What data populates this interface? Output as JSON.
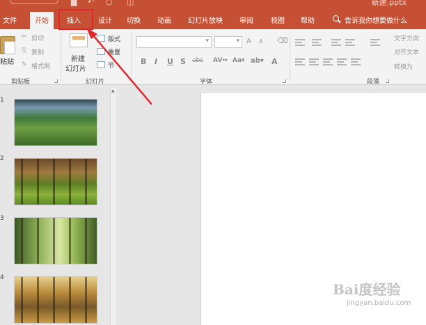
{
  "titlebar": {
    "filename": "新建.pptx"
  },
  "tabs": [
    {
      "label": "文件",
      "active": false
    },
    {
      "label": "开始",
      "active": true
    },
    {
      "label": "插入",
      "active": false
    },
    {
      "label": "设计",
      "active": false
    },
    {
      "label": "切换",
      "active": false
    },
    {
      "label": "动画",
      "active": false
    },
    {
      "label": "幻灯片放映",
      "active": false
    },
    {
      "label": "审阅",
      "active": false
    },
    {
      "label": "视图",
      "active": false
    },
    {
      "label": "帮助",
      "active": false
    }
  ],
  "tell_me": {
    "placeholder": "告诉我你想要做什么"
  },
  "ribbon": {
    "clipboard": {
      "label": "剪贴板",
      "paste": "粘贴",
      "cut": "剪切",
      "copy": "复制",
      "format_painter": "格式刷"
    },
    "slides": {
      "label": "幻灯片",
      "new_slide_line1": "新建",
      "new_slide_line2": "幻灯片",
      "layout": "版式",
      "reset": "重置",
      "section": "节"
    },
    "font": {
      "label": "字体",
      "bold": "B",
      "italic": "I",
      "underline": "U",
      "shadow": "S",
      "strike": "abc",
      "grow": "A",
      "shrink": "A",
      "color": "A"
    },
    "paragraph": {
      "label": "段落",
      "text_direction": "文字方向",
      "align_text": "对齐文本",
      "smartart": "转换为"
    }
  },
  "slides": [
    {
      "number": "1"
    },
    {
      "number": "2"
    },
    {
      "number": "3"
    },
    {
      "number": "4"
    }
  ],
  "annotation": {
    "color": "#e3262c",
    "target": "插入"
  },
  "watermark": {
    "title": "Bai度经验",
    "url": "jingyan.baidu.com"
  },
  "colors": {
    "accent": "#c55033",
    "ribbon_bg": "#f3f3f3",
    "workspace": "#e6e6e6"
  }
}
